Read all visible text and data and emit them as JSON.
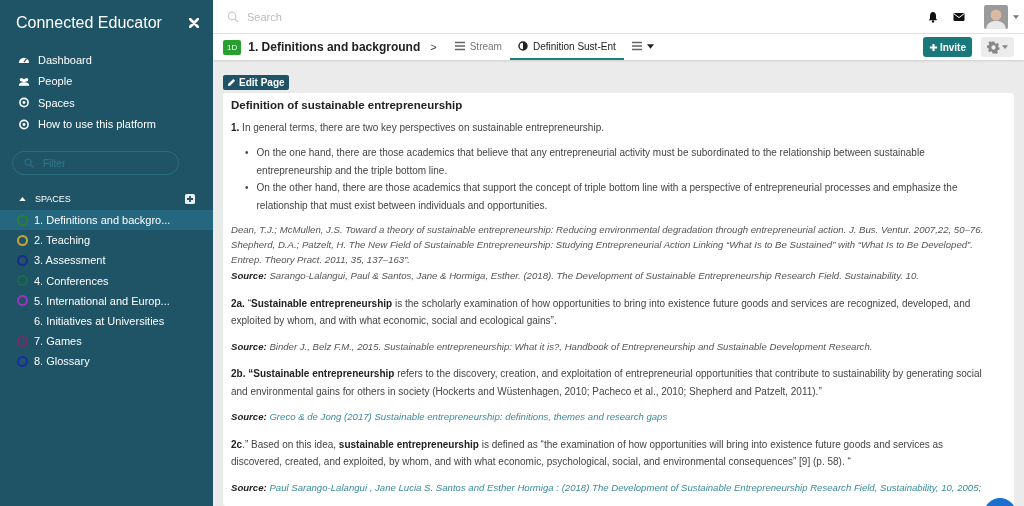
{
  "sidebar": {
    "title": "Connected Educator",
    "nav": [
      {
        "label": "Dashboard"
      },
      {
        "label": "People"
      },
      {
        "label": "Spaces"
      },
      {
        "label": "How to use this platform"
      }
    ],
    "filter": {
      "placeholder": "Filter"
    },
    "spaces_header": "SPACES",
    "spaces": [
      {
        "label": "1. Definitions and backgro...",
        "color": "#2e7d32",
        "selected": true
      },
      {
        "label": "2. Teaching",
        "color": "#c9a33a",
        "selected": false
      },
      {
        "label": "3. Assessment",
        "color": "#1e2a8a",
        "selected": false
      },
      {
        "label": "4. Conferences",
        "color": "#1b6b45",
        "selected": false
      },
      {
        "label": "5. International and Europ...",
        "color": "#a030c0",
        "selected": false
      },
      {
        "label": "6. Initiatives at Universities",
        "selected": false
      },
      {
        "label": "7. Games",
        "color": "#7a2a6a",
        "selected": false
      },
      {
        "label": "8. Glossary",
        "color": "#1a2ea0",
        "selected": false
      }
    ]
  },
  "topbar": {
    "search": {
      "placeholder": "Search"
    }
  },
  "spacebar": {
    "badge": "1D",
    "title": "1. Definitions and background",
    "separator": ">",
    "tabs": [
      {
        "kind": "stream",
        "label": "Stream",
        "selected": false
      },
      {
        "kind": "page",
        "label": "Definition Sust-Ent",
        "selected": true
      },
      {
        "kind": "menu",
        "selected": false
      }
    ],
    "invite": "Invite"
  },
  "edit_button": "Edit Page",
  "content": [
    {
      "kind": "heading",
      "text": "Definition of sustainable entrepreneurship"
    },
    {
      "kind": "paragraph",
      "text": "**1.** In general terms, there are two key perspectives on sustainable entrepreneurship."
    },
    {
      "kind": "bullets",
      "marker": "•",
      "items": [
        "On the one hand, there are those academics that believe that any entrepreneurial activity must be subordinated to the relationship between sustainable entrepreneurship and the triple bottom line.",
        "On the other hand, there are those academics that support the concept of triple bottom line with a perspective of entrepreneurial processes and emphasize the relationship that must exist between individuals and opportunities."
      ]
    },
    {
      "kind": "citation",
      "lines": [
        "Dean, T.J.; McMullen, J.S. Toward a theory of sustainable entrepreneurship: Reducing environmental degradation through entrepreneurial action. J. Bus. Ventur. 2007,22, 50–76.",
        "Shepherd, D.A.; Patzelt, H. The New Field of Sustainable Entrepreneurship: Studying Entrepreneurial Action Linking “What Is to Be Sustained” with “What Is to Be Developed”.",
        "Entrep. Theory Pract. 2011, 35, 137–163”."
      ]
    },
    {
      "kind": "source",
      "label": "Source:",
      "text": "Sarango-Lalangui, Paul & Santos, Jane & Hormiga, Esther. (2018). The Development of Sustainable Entrepreneurship Research Field. Sustainability. 10.",
      "linked": false
    },
    {
      "kind": "paragraph",
      "text": "**2a.** “**Sustainable entrepreneurship** is the scholarly examination of how opportunities to bring into existence future goods and services are recognized, developed, and exploited by whom, and with what economic, social and ecological gains”."
    },
    {
      "kind": "source",
      "label": "Source:",
      "text": "Binder J., Belz F.M., 2015. Sustainable entrepreneurship: What it is?, Handbook of Entrepreneurship and Sustainable Development Research.",
      "linked": false
    },
    {
      "kind": "paragraph",
      "text": "**2b. “Sustainable entrepreneurship** refers to the discovery, creation, and exploitation of entrepreneurial opportunities that contribute to sustainability by generating social and environmental gains for others in society (Hockerts and Wüstenhagen, 2010; Pacheco et al., 2010; Shepherd and Patzelt, 2011).”"
    },
    {
      "kind": "source",
      "label": "Source:",
      "text": "Greco & de Jong (2017) Sustainable entrepreneurship: definitions, themes and research gaps",
      "linked": true
    },
    {
      "kind": "paragraph",
      "text": "**2c**.” Based on this idea, **sustainable entrepreneurship** is defined as “the examination of how opportunities will bring into existence future goods and services as discovered, created, and exploited, by whom, and with what economic, psychological, social, and environmental consequences” [9] (p. 58). “"
    },
    {
      "kind": "source",
      "label": "Source:",
      "text": "Paul Sarango-Lalangui , Jane Lucia S. Santos and Esther Hormiga : (2018) The Development of Sustainable Entrepreneurship Research Field, Sustainability, 10, 2005;",
      "linked": true
    }
  ]
}
